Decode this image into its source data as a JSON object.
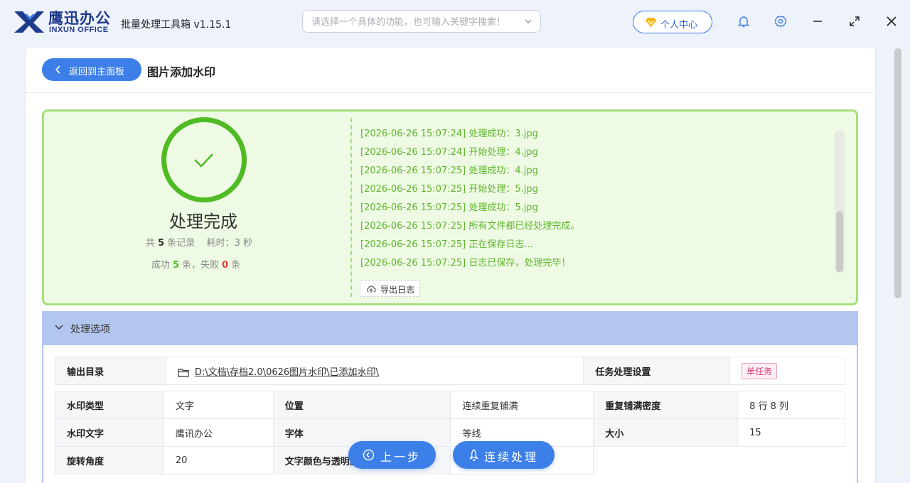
{
  "app": {
    "brand_cn": "鹰迅办公",
    "brand_en": "INXUN OFFICE",
    "title": "批量处理工具箱 v1.15.1",
    "search_placeholder": "请选择一个具体的功能，也可输入关键字搜索！",
    "user_center_label": "个人中心"
  },
  "header": {
    "back_label": "返回到主面板",
    "page_title": "图片添加水印"
  },
  "result": {
    "status": "处理完成",
    "total_prefix": "共",
    "total_count": "5",
    "total_suffix": "条记录",
    "time_label": "耗时：3 秒",
    "success_prefix": "成功",
    "success_count": "5",
    "success_suffix": "条，失败",
    "fail_count": "0",
    "fail_suffix": "条",
    "log_lines": [
      "[2026-06-26 15:07:24] 处理成功：3.jpg",
      "[2026-06-26 15:07:24] 开始处理：4.jpg",
      "[2026-06-26 15:07:25] 处理成功：4.jpg",
      "[2026-06-26 15:07:25] 开始处理：5.jpg",
      "[2026-06-26 15:07:25] 处理成功：5.jpg",
      "[2026-06-26 15:07:25] 所有文件都已经处理完成。",
      "[2026-06-26 15:07:25] 正在保存日志...",
      "[2026-06-26 15:07:25] 日志已保存，处理完毕！"
    ],
    "export_label": "导出日志"
  },
  "options": {
    "section_label": "处理选项",
    "output_dir_label": "输出目录",
    "output_dir_value": "D:\\文档\\存档2.0\\0626图片水印\\已添加水印\\",
    "task_setting_label": "任务处理设置",
    "task_setting_value": "单任务",
    "rows": [
      [
        {
          "k": "水印类型",
          "v": "文字"
        },
        {
          "k": "位置",
          "v": "连续重复铺满"
        },
        {
          "k": "重复铺满密度",
          "v": "8 行 8 列"
        }
      ],
      [
        {
          "k": "水印文字",
          "v": "鹰讯办公"
        },
        {
          "k": "字体",
          "v": "等线"
        },
        {
          "k": "大小",
          "v": "15"
        }
      ],
      [
        {
          "k": "旋转角度",
          "v": "20"
        },
        {
          "k": "文字颜色与透明度",
          "v": ""
        },
        {
          "k": "",
          "v": ""
        }
      ]
    ]
  },
  "footer": {
    "prev_label": "上一步",
    "continue_label": "连续处理"
  },
  "colors": {
    "accent": "#3d7fe8",
    "success": "#4fbb24",
    "fail": "#e43d3d",
    "result_bg": "#eefae4",
    "options_header": "#b3c6ee"
  },
  "icons": [
    "app-logo-icon",
    "chevron-down-icon",
    "diamond-icon",
    "bell-icon",
    "gear-icon",
    "minimize-icon",
    "maximize-icon",
    "close-icon",
    "chevron-left-icon",
    "check-icon",
    "cloud-upload-icon",
    "folder-icon",
    "clock-back-icon",
    "rocket-icon"
  ]
}
